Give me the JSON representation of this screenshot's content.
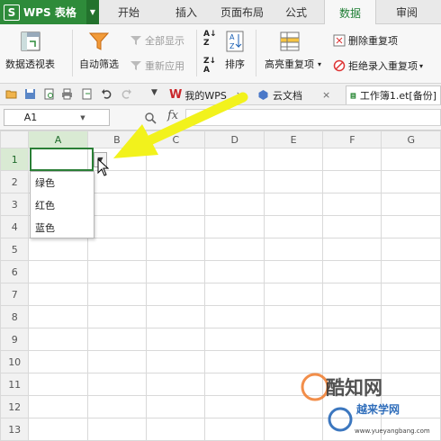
{
  "app": {
    "name": "WPS 表格",
    "logo_glyph": "S",
    "accent_color": "#2e8b3a"
  },
  "menu": {
    "tabs": [
      {
        "label": "开始"
      },
      {
        "label": "插入"
      },
      {
        "label": "页面布局"
      },
      {
        "label": "公式"
      },
      {
        "label": "数据"
      },
      {
        "label": "审阅"
      }
    ],
    "active_tab": "数据"
  },
  "ribbon": {
    "pivot_table": "数据透视表",
    "auto_filter": "自动筛选",
    "show_all": "全部显示",
    "reapply": "重新应用",
    "sort": "排序",
    "highlight_duplicates": "高亮重复项",
    "remove_duplicates": "删除重复项",
    "reject_duplicates": "拒绝录入重复项"
  },
  "doc_tabs": [
    {
      "label": "我的WPS",
      "icon": "wps-icon"
    },
    {
      "label": "云文档",
      "icon": "cloud-doc-icon"
    },
    {
      "label": "工作簿1.et[备份]",
      "icon": "sheet-icon"
    }
  ],
  "formula_bar": {
    "name_box": "A1",
    "fx": "fx",
    "value": ""
  },
  "grid": {
    "columns": [
      "A",
      "B",
      "C",
      "D",
      "E",
      "F",
      "G"
    ],
    "rows": [
      "1",
      "2",
      "3",
      "4",
      "5",
      "6",
      "7",
      "8",
      "9",
      "10",
      "11",
      "12",
      "13"
    ],
    "active_cell": "A1",
    "selection_color": "#2a7f36"
  },
  "dropdown": {
    "options": [
      "绿色",
      "红色",
      "蓝色"
    ]
  },
  "annotation": {
    "arrow_color": "#f2f21c"
  },
  "watermark": {
    "title": "酷知网",
    "subtitle": "越来学网",
    "url": "www.yueyangbang.com"
  }
}
